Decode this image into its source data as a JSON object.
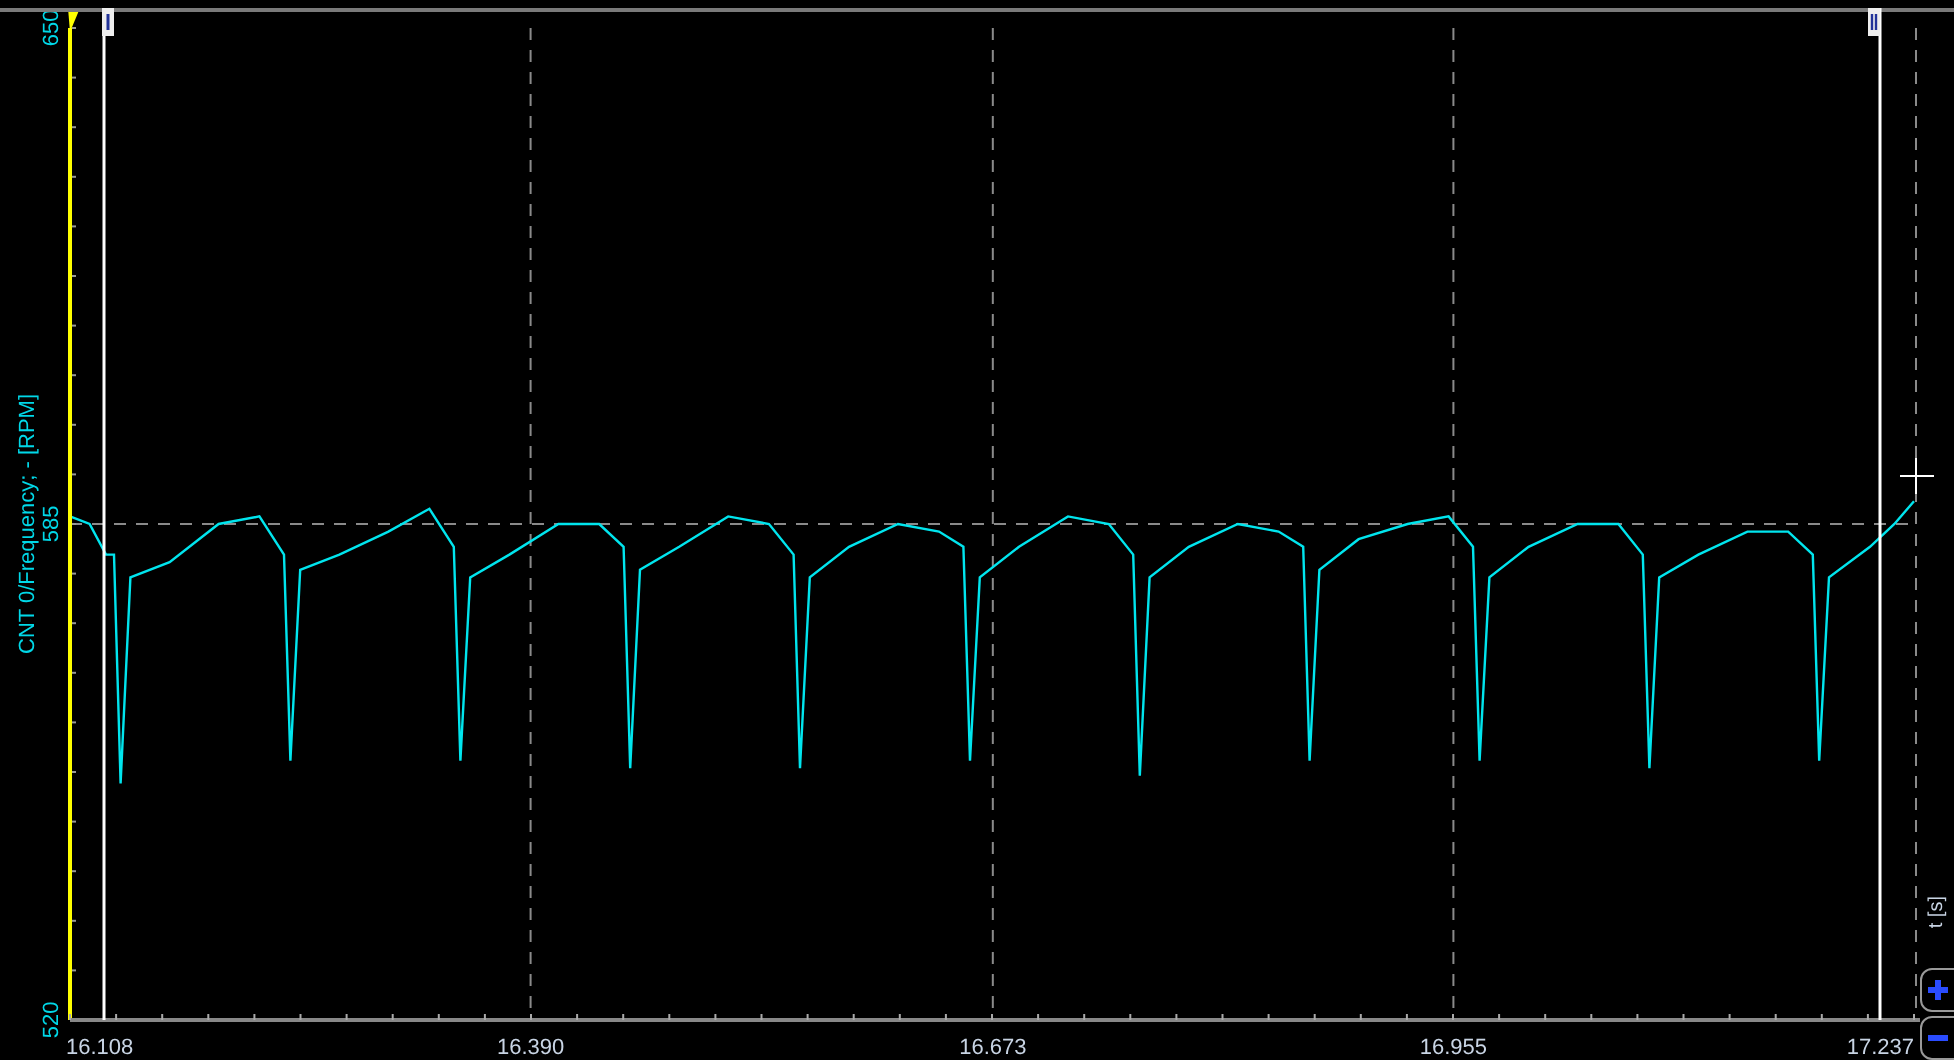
{
  "x_axis_panel": {
    "label": "t [s]"
  },
  "chart_data": {
    "type": "line",
    "ylabel": "CNT 0/Frequency; - [RPM]",
    "grid": true,
    "x": [
      16.108,
      16.12,
      16.13,
      16.135,
      16.139,
      16.145,
      16.169,
      16.199,
      16.224,
      16.239,
      16.243,
      16.249,
      16.273,
      16.303,
      16.328,
      16.343,
      16.347,
      16.353,
      16.377,
      16.407,
      16.432,
      16.447,
      16.451,
      16.457,
      16.481,
      16.511,
      16.536,
      16.551,
      16.555,
      16.561,
      16.585,
      16.615,
      16.64,
      16.655,
      16.659,
      16.665,
      16.689,
      16.719,
      16.744,
      16.759,
      16.763,
      16.769,
      16.793,
      16.823,
      16.848,
      16.863,
      16.867,
      16.873,
      16.897,
      16.927,
      16.952,
      16.967,
      16.971,
      16.977,
      17.001,
      17.031,
      17.056,
      17.071,
      17.075,
      17.081,
      17.105,
      17.135,
      17.16,
      17.175,
      17.179,
      17.185,
      17.21,
      17.225,
      17.237
    ],
    "series": [
      {
        "color": "#00e5ee",
        "values": [
          586,
          585,
          581,
          581,
          551,
          578,
          580,
          585,
          586,
          581,
          554,
          579,
          581,
          584,
          587,
          582,
          554,
          578,
          581,
          585,
          585,
          582,
          553,
          579,
          582,
          586,
          585,
          581,
          553,
          578,
          582,
          585,
          584,
          582,
          554,
          578,
          582,
          586,
          585,
          581,
          552,
          578,
          582,
          585,
          584,
          582,
          554,
          579,
          583,
          585,
          586,
          582,
          554,
          578,
          582,
          585,
          585,
          581,
          553,
          578,
          581,
          584,
          584,
          581,
          554,
          578,
          582,
          585,
          588
        ]
      }
    ],
    "xlim": [
      16.108,
      17.237
    ],
    "ylim": [
      520,
      650
    ],
    "xticks": [
      {
        "value": 16.108,
        "label": "16.108"
      },
      {
        "value": 16.39,
        "label": "16.390"
      },
      {
        "value": 16.673,
        "label": "16.673"
      },
      {
        "value": 16.955,
        "label": "16.955"
      },
      {
        "value": 17.237,
        "label": "17.237"
      }
    ],
    "yticks": [
      520,
      585,
      650
    ]
  }
}
